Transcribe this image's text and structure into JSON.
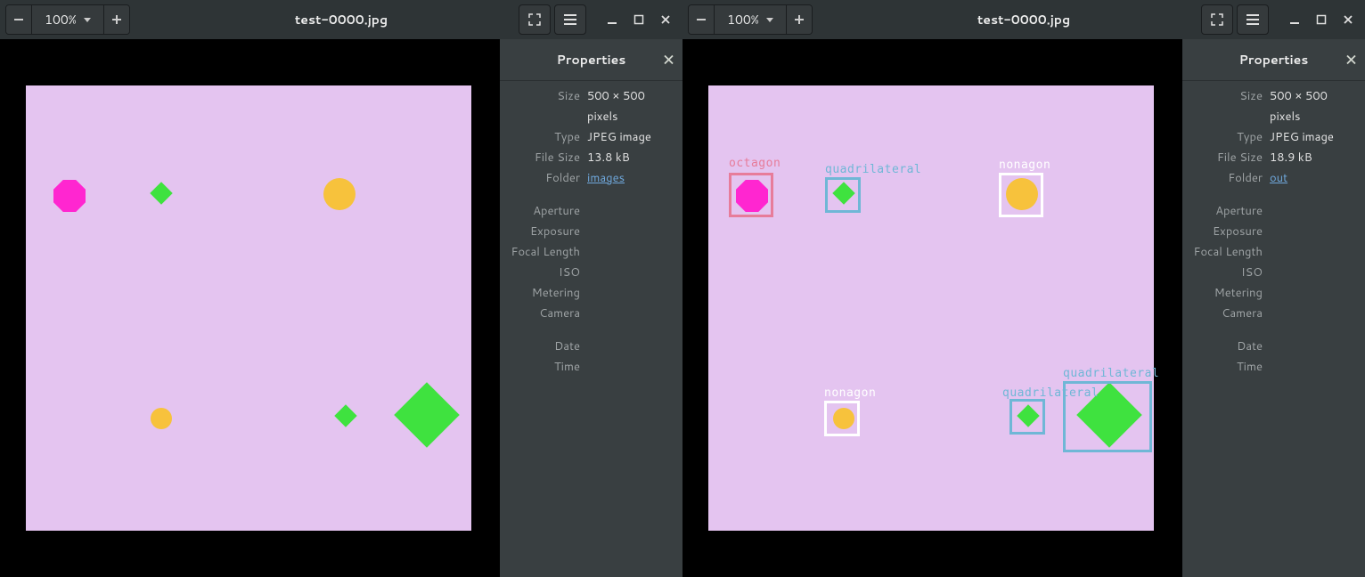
{
  "viewers": [
    {
      "zoom": "100%",
      "title": "test-0000.jpg",
      "props_title": "Properties",
      "properties": {
        "size_k": "Size",
        "size_v": "500 × 500 pixels",
        "type_k": "Type",
        "type_v": "JPEG image",
        "filesize_k": "File Size",
        "filesize_v": "13.8 kB",
        "folder_k": "Folder",
        "folder_v": "images",
        "aperture_k": "Aperture",
        "exposure_k": "Exposure",
        "focal_k": "Focal Length",
        "iso_k": "ISO",
        "metering_k": "Metering",
        "camera_k": "Camera",
        "date_k": "Date",
        "time_k": "Time"
      }
    },
    {
      "zoom": "100%",
      "title": "test-0000.jpg",
      "props_title": "Properties",
      "properties": {
        "size_k": "Size",
        "size_v": "500 × 500 pixels",
        "type_k": "Type",
        "type_v": "JPEG image",
        "filesize_k": "File Size",
        "filesize_v": "18.9 kB",
        "folder_k": "Folder",
        "folder_v": "out",
        "aperture_k": "Aperture",
        "exposure_k": "Exposure",
        "focal_k": "Focal Length",
        "iso_k": "ISO",
        "metering_k": "Metering",
        "camera_k": "Camera",
        "date_k": "Date",
        "time_k": "Time"
      },
      "detections": {
        "octagon": "octagon",
        "quadrilateral": "quadrilateral",
        "nonagon": "nonagon",
        "nonagon2": "nonagon",
        "quadrilateral2": "quadrilateral",
        "quadrilateral3": "quadrilateral"
      }
    }
  ]
}
